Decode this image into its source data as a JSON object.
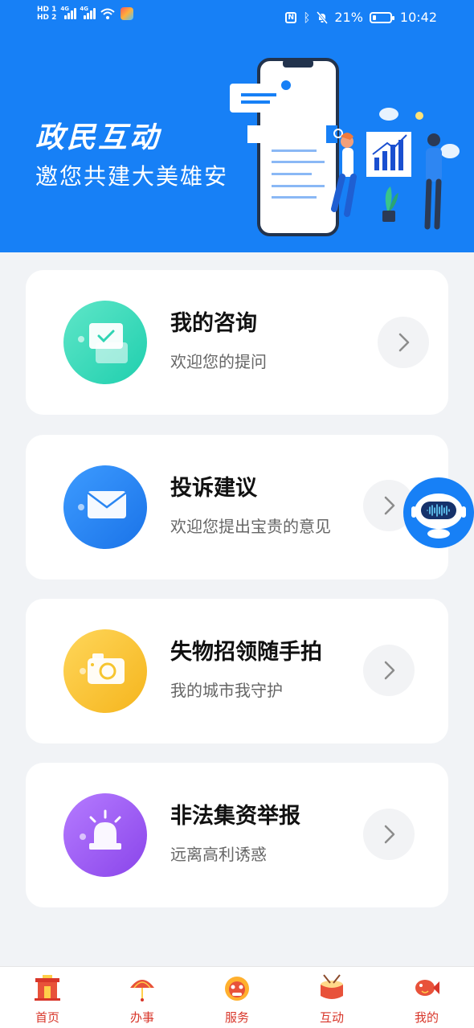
{
  "status_bar": {
    "sim1": "HD 1",
    "sim2": "HD 2",
    "net1": "4G",
    "net2": "4G",
    "battery": "21%",
    "battery_level": 0.21,
    "time": "10:42"
  },
  "banner": {
    "title": "政民互动",
    "subtitle": "邀您共建大美雄安"
  },
  "cards": [
    {
      "title": "我的咨询",
      "desc": "欢迎您的提问",
      "icon": "chat-bubbles-icon",
      "color": "#2fd4b3"
    },
    {
      "title": "投诉建议",
      "desc": "欢迎您提出宝贵的意见",
      "icon": "envelope-icon",
      "color": "#2a86f2"
    },
    {
      "title": "失物招领随手拍",
      "desc": "我的城市我守护",
      "icon": "camera-icon",
      "color": "#f6c52f"
    },
    {
      "title": "非法集资举报",
      "desc": "远离高利诱惑",
      "icon": "alarm-light-icon",
      "color": "#9a58ee"
    }
  ],
  "tabs": [
    {
      "label": "首页",
      "icon": "home-gate-icon"
    },
    {
      "label": "办事",
      "icon": "umbrella-icon"
    },
    {
      "label": "服务",
      "icon": "lion-head-icon"
    },
    {
      "label": "互动",
      "icon": "drum-icon"
    },
    {
      "label": "我的",
      "icon": "koi-fish-icon"
    }
  ],
  "accent_color": "#1780f6",
  "tab_color": "#d8362a"
}
